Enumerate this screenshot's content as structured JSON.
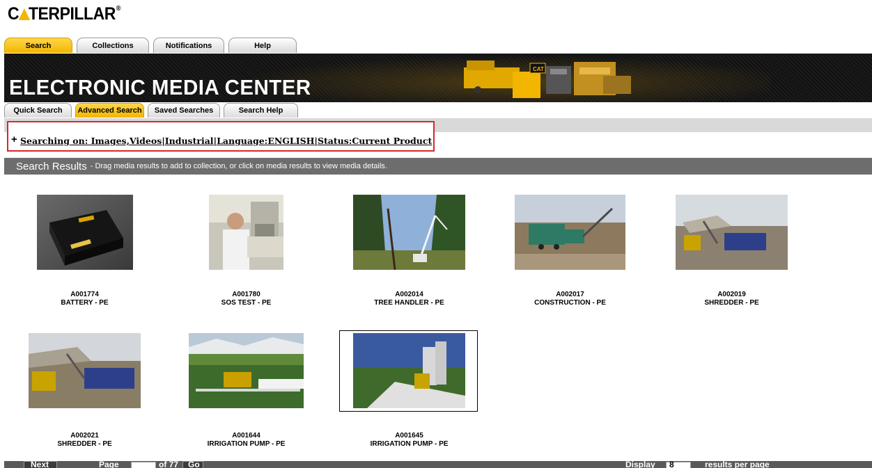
{
  "brand": {
    "name_prefix": "C",
    "name_suffix": "TERPILLAR",
    "reg": "®",
    "accent": "#f2b600"
  },
  "main_tabs": [
    {
      "label": "Search",
      "active": true
    },
    {
      "label": "Collections",
      "active": false
    },
    {
      "label": "Notifications",
      "active": false
    },
    {
      "label": "Help",
      "active": false
    }
  ],
  "banner": {
    "title": "ELECTRONIC MEDIA CENTER"
  },
  "sub_tabs": [
    {
      "label": "Quick Search",
      "active": false
    },
    {
      "label": "Advanced Search",
      "active": true
    },
    {
      "label": "Saved Searches",
      "active": false
    },
    {
      "label": "Search Help",
      "active": false
    }
  ],
  "criteria": {
    "expand": "+",
    "text": "Searching on: Images,Videos|Industrial|Language:ENGLISH|Status:Current Product",
    "highlight_color": "#d9262b"
  },
  "results_header": {
    "title": "Search Results",
    "hint": " - Drag media results to add to collection, or click on media results to view media details."
  },
  "results": [
    {
      "code": "A001774",
      "name": "BATTERY - PE",
      "thumb": "battery"
    },
    {
      "code": "A001780",
      "name": "SOS TEST - PE",
      "thumb": "lab"
    },
    {
      "code": "A002014",
      "name": "TREE HANDLER - PE",
      "thumb": "forest"
    },
    {
      "code": "A002017",
      "name": "CONSTRUCTION - PE",
      "thumb": "site"
    },
    {
      "code": "A002019",
      "name": "SHREDDER - PE",
      "thumb": "shredder"
    },
    {
      "code": "A002021",
      "name": "SHREDDER - PE",
      "thumb": "shredder2"
    },
    {
      "code": "A001644",
      "name": "IRRIGATION PUMP - PE",
      "thumb": "field"
    },
    {
      "code": "A001645",
      "name": "IRRIGATION PUMP - PE",
      "thumb": "pump",
      "selected": true
    }
  ],
  "pager": {
    "next": "Next",
    "page_label": "Page",
    "of_text": "of 77",
    "go": "Go",
    "display": "Display",
    "per_page_value": "8",
    "per_page_suffix": "results per page"
  }
}
